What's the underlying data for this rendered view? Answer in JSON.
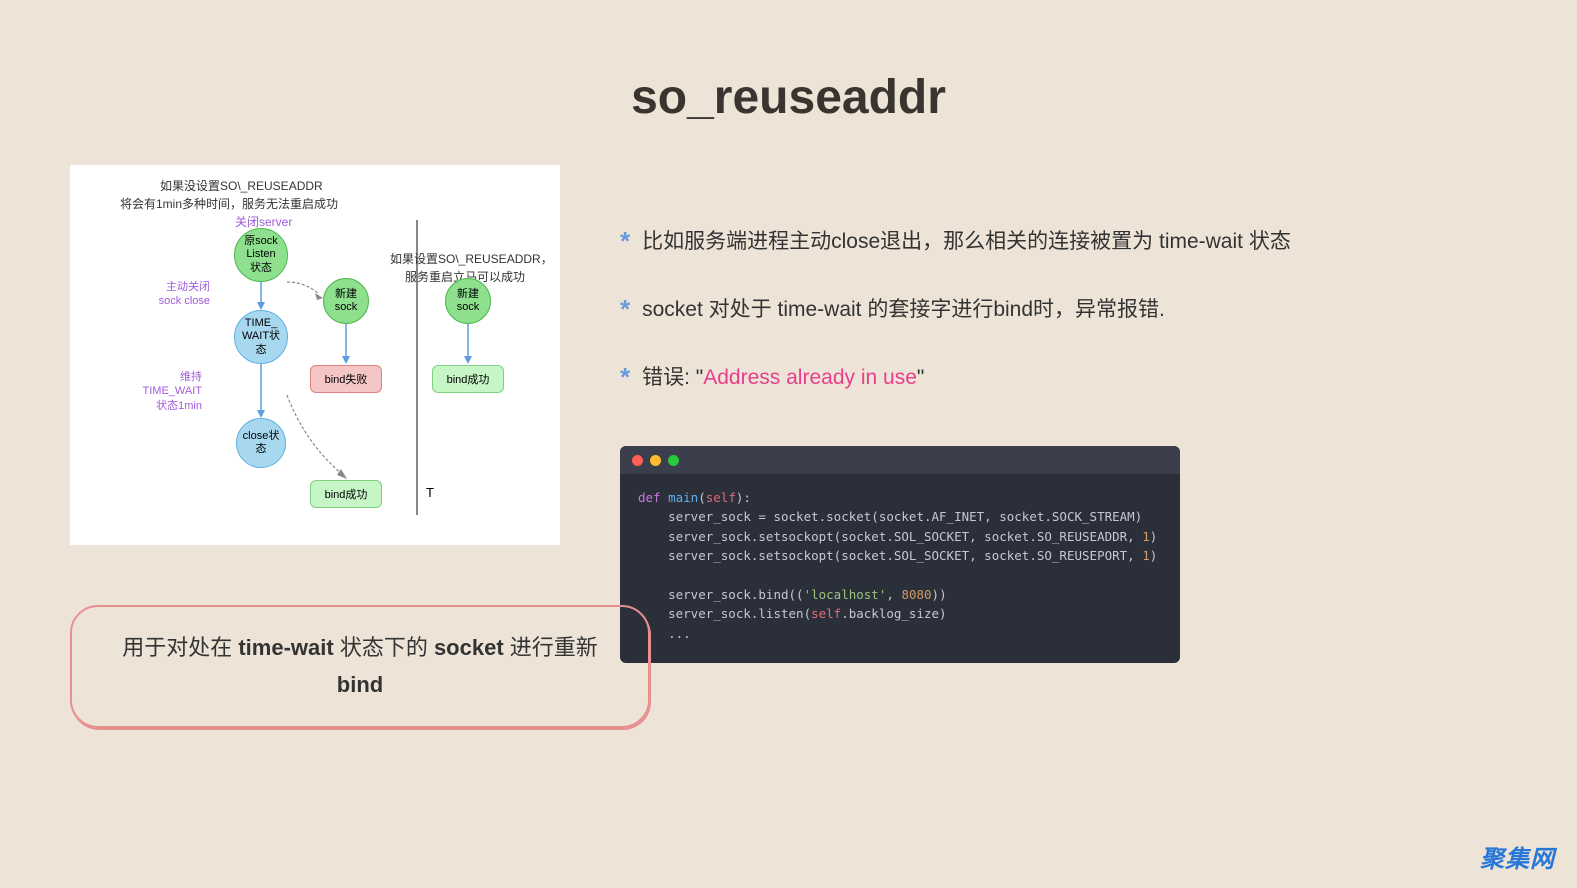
{
  "title": "so_reuseaddr",
  "diagram": {
    "hdr1": "如果没设置SO\\_REUSEADDR",
    "hdr2": "将会有1min多种时间，服务无法重启成功",
    "closeServer": "关闭server",
    "node_orig": "原sock\nListen\n状态",
    "side_active": "主动关闭\nsock close",
    "node_new1": "新建\nsock",
    "node_tw": "TIME_\nWAIT状\n态",
    "side_maintain": "维持TIME_WAIT\n状态1min",
    "bind_fail": "bind失败",
    "node_close": "close状\n态",
    "bind_ok1": "bind成功",
    "right_hdr1": "如果设置SO\\_REUSEADDR，",
    "right_hdr2": "服务重启立马可以成功",
    "node_new2": "新建\nsock",
    "bind_ok2": "bind成功",
    "t": "T"
  },
  "callout_line1_a": "用于对处在 ",
  "callout_tw": "time-wait",
  "callout_line1_b": " 状态下的 ",
  "callout_sock": "socket",
  "callout_line1_c": " 进行重新",
  "callout_line2": "bind",
  "bullets": [
    {
      "full": "比如服务端进程主动close退出，那么相关的连接被置为 time-wait 状态"
    },
    {
      "full": "socket 对处于 time-wait 的套接字进行bind时，异常报错."
    },
    {
      "prefix": "错误: \"",
      "hl": "Address already in use",
      "suffix": "\""
    }
  ],
  "code": {
    "l1a": "def ",
    "l1b": "main",
    "l1c": "(",
    "l1d": "self",
    "l1e": "):",
    "l2": "    server_sock = socket.socket(socket.AF_INET, socket.SOCK_STREAM)",
    "l3a": "    server_sock.setsockopt(socket.SOL_SOCKET, socket.SO_REUSEADDR, ",
    "l3b": "1",
    "l3c": ")",
    "l4a": "    server_sock.setsockopt(socket.SOL_SOCKET, socket.SO_REUSEPORT, ",
    "l4b": "1",
    "l4c": ")",
    "l5": "",
    "l6a": "    server_sock.bind((",
    "l6b": "'localhost'",
    "l6c": ", ",
    "l6d": "8080",
    "l6e": "))",
    "l7a": "    server_sock.listen(",
    "l7b": "self",
    "l7c": ".backlog_size)",
    "l8": "    ..."
  },
  "watermark": "聚集网"
}
